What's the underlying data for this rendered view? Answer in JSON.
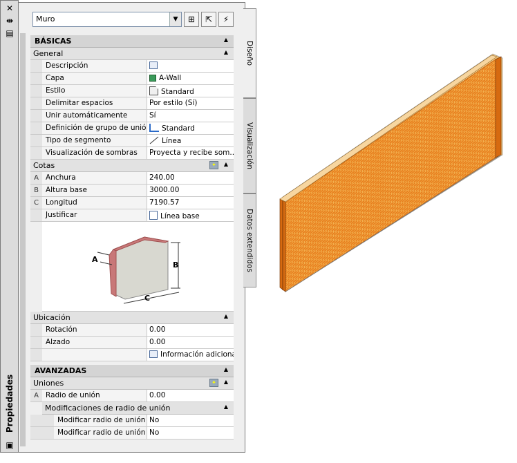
{
  "palette_title": "Propiedades",
  "tabs": [
    "Diseño",
    "Visualización",
    "Datos extendidos"
  ],
  "object_selector": {
    "value": "Muro"
  },
  "basic": {
    "category": "BÁSICAS",
    "general": {
      "group": "General",
      "rows": [
        {
          "name": "Descripción",
          "value": "",
          "icon": "description-icon"
        },
        {
          "name": "Capa",
          "value": "A-Wall",
          "icon": "layer-color-icon"
        },
        {
          "name": "Estilo",
          "value": "Standard",
          "icon": "style-icon"
        },
        {
          "name": "Delimitar espacios",
          "value": "Por estilo (Sí)"
        },
        {
          "name": "Unir automáticamente",
          "value": "Sí"
        },
        {
          "name": "Definición de grupo de unión",
          "value": "Standard",
          "icon": "join-group-icon"
        },
        {
          "name": "Tipo de segmento",
          "value": "Línea",
          "icon": "line-segment-icon"
        },
        {
          "name": "Visualización de sombras",
          "value": "Proyecta y recibe som..."
        }
      ]
    },
    "dimensions": {
      "group": "Cotas",
      "rows": [
        {
          "letter": "A",
          "name": "Anchura",
          "value": "240.00"
        },
        {
          "letter": "B",
          "name": "Altura base",
          "value": "3000.00"
        },
        {
          "letter": "C",
          "name": "Longitud",
          "value": "7190.57"
        },
        {
          "letter": "",
          "name": "Justificar",
          "value": "Línea base",
          "icon": "justify-icon"
        }
      ],
      "diagram_labels": {
        "a": "A",
        "b": "B",
        "c": "C"
      }
    },
    "location": {
      "group": "Ubicación",
      "rows": [
        {
          "name": "Rotación",
          "value": "0.00"
        },
        {
          "name": "Alzado",
          "value": "0.00"
        },
        {
          "name": "",
          "value": "Información adicional",
          "icon": "info-icon"
        }
      ]
    }
  },
  "advanced": {
    "category": "AVANZADAS",
    "joins": {
      "group": "Uniones",
      "rows": [
        {
          "letter": "A",
          "name": "Radio de unión",
          "value": "0.00"
        }
      ],
      "sub_group": "Modificaciones de radio de unión",
      "sub_rows": [
        {
          "name": "Modificar radio de unión ...",
          "value": "No"
        },
        {
          "name": "Modificar radio de unión ...",
          "value": "No"
        }
      ]
    }
  },
  "colors": {
    "brick": "#e87a1c",
    "mortar": "#f5c97a",
    "panel": "#efefef"
  }
}
